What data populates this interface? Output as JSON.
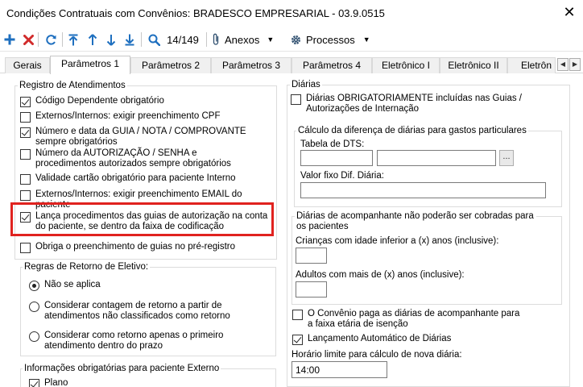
{
  "window": {
    "title": "Condições Contratuais com Convênios: BRADESCO EMPRESARIAL - 03.9.0515",
    "close_glyph": "✕"
  },
  "toolbar": {
    "counter": "14/149",
    "anexos_label": "Anexos",
    "processos_label": "Processos"
  },
  "tabs": [
    {
      "label": "Gerais",
      "active": false
    },
    {
      "label": "Parâmetros 1",
      "active": true
    },
    {
      "label": "Parâmetros 2",
      "active": false
    },
    {
      "label": "Parâmetros 3",
      "active": false
    },
    {
      "label": "Parâmetros 4",
      "active": false
    },
    {
      "label": "Eletrônico I",
      "active": false
    },
    {
      "label": "Eletrônico II",
      "active": false
    },
    {
      "label": "Eletrôn",
      "active": false
    }
  ],
  "left": {
    "registro": {
      "title": "Registro de Atendimentos",
      "items": [
        {
          "label": "Código Dependente obrigatório",
          "checked": true
        },
        {
          "label": "Externos/Internos: exigir preenchimento CPF",
          "checked": false
        },
        {
          "label": "Número e data da GUIA / NOTA / COMPROVANTE sempre obrigatórios",
          "checked": true
        },
        {
          "label": "Número da AUTORIZAÇÃO / SENHA e procedimentos autorizados sempre obrigatórios",
          "checked": false
        },
        {
          "label": "Validade cartão obrigatório para paciente Interno",
          "checked": false
        },
        {
          "label": "Externos/Internos: exigir preenchimento EMAIL do paciente",
          "checked": false
        },
        {
          "label": "Lança procedimentos das guias de autorização na conta do paciente, se dentro da faixa de codificação",
          "checked": true
        },
        {
          "label": "Obriga o preenchimento de guias no pré-registro",
          "checked": false
        }
      ]
    },
    "retorno": {
      "title": "Regras de Retorno de Eletivo:",
      "options": [
        {
          "label": "Não se aplica",
          "selected": true
        },
        {
          "label": "Considerar contagem de retorno a partir de atendimentos não classificados como retorno",
          "selected": false
        },
        {
          "label": "Considerar como retorno apenas o primeiro atendimento dentro do prazo",
          "selected": false
        }
      ]
    },
    "externo": {
      "title": "Informações obrigatórias para paciente Externo",
      "items": [
        {
          "label": "Plano",
          "checked": true
        }
      ]
    }
  },
  "right": {
    "diarias": {
      "title": "Diárias",
      "obrigatorias": {
        "label": "Diárias OBRIGATORIAMENTE incluídas nas Guias / Autorizações de Internação",
        "checked": false
      },
      "calculo": {
        "title": "Cálculo da diferença de diárias para gastos particulares",
        "tabela_dts_label": "Tabela de DTS:",
        "tabela_dts_code": "",
        "tabela_dts_name": "",
        "lookup_label": "...",
        "valor_fixo_label": "Valor fixo Dif. Diária:",
        "valor_fixo_value": ""
      },
      "acompanhante": {
        "title": "Diárias de acompanhante não poderão ser cobradas para os pacientes",
        "criancas_label": "Crianças com idade inferior a (x) anos (inclusive):",
        "criancas_value": "",
        "adultos_label": "Adultos com mais de (x) anos (inclusive):",
        "adultos_value": ""
      },
      "paga_acompanhante": {
        "label": "O Convênio paga as diárias de acompanhante para a faixa etária de isenção",
        "checked": false
      },
      "lancamento_automatico": {
        "label": "Lançamento Automático de Diárias",
        "checked": true
      },
      "horario_label": "Horário limite para cálculo de nova diária:",
      "horario_value": "14:00"
    }
  },
  "colors": {
    "highlight": "#e0221f",
    "add_icon": "#1e6fbf",
    "delete_icon": "#d12b2b",
    "nav_icon": "#1e6fbf"
  }
}
